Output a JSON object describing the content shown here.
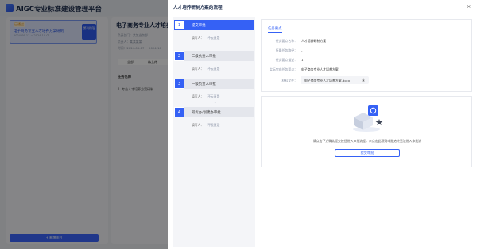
{
  "background": {
    "app_title": "AIGC专业标准建设管理平台",
    "card": {
      "tag": "已通过",
      "title": "电子商务专业人才培养方案研制",
      "date": "2024-09-17 ~ 2024-10-01",
      "badge": "第1阶段"
    },
    "add_button": "+ 新增项目",
    "detail_title": "电子商务专业人才培养方",
    "detail_lines": [
      "负责部门：某某业务部",
      "负责人：某某某某",
      "时间：2024-09-17 ~ 2024-10"
    ],
    "tabs": [
      "全部",
      "待上传"
    ],
    "table_header": "任务名称",
    "table_row": "1. 专业人才培养方案研制"
  },
  "modal": {
    "title": "人才培养研制方案的流程",
    "close": "×",
    "steps": [
      {
        "num": "1",
        "label": "提交审批",
        "filler_key": "填写人：",
        "filler_val": "不云直是",
        "active": true
      },
      {
        "num": "2",
        "label": "二级负责人审批",
        "filler_key": "填写人：",
        "filler_val": "不云直是",
        "active": false
      },
      {
        "num": "3",
        "label": "一级负责人审批",
        "filler_key": "填写人：",
        "filler_val": "不云直是",
        "active": false
      },
      {
        "num": "4",
        "label": "双优办/创建办审批",
        "filler_key": "填写人：",
        "filler_val": "不云直是",
        "active": false
      }
    ],
    "step_arrow": "↓",
    "info": {
      "heading": "任务要点",
      "rows": [
        {
          "key": "任务要点名称：",
          "value": "人才培养研制方案"
        },
        {
          "key": "所属任务路径：",
          "value": "-"
        },
        {
          "key": "任务要点描述：",
          "value": "1"
        },
        {
          "key": "实际完成任务要点：",
          "value": "电子商务专业人才培养方案"
        },
        {
          "key": "材料文件：",
          "value": ""
        }
      ],
      "file_name": "电子商务专业人才培养方案.docx"
    },
    "approve": {
      "tip": "请点击下方确认提交按钮进入审批流程，未点击此项则审批始终无法进入审批流",
      "button": "提交审批"
    }
  },
  "colors": {
    "accent": "#3561f5",
    "overlay": "rgba(0,0,0,0.46)"
  }
}
